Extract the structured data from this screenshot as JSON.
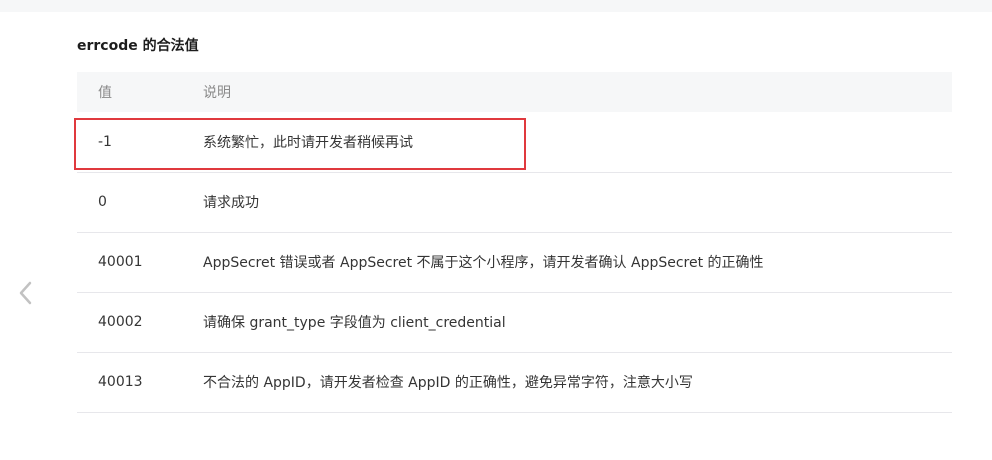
{
  "section": {
    "title": "errcode 的合法值"
  },
  "table": {
    "headers": {
      "value": "值",
      "description": "说明"
    },
    "rows": [
      {
        "value": "-1",
        "description": "系统繁忙，此时请开发者稍候再试"
      },
      {
        "value": "0",
        "description": "请求成功"
      },
      {
        "value": "40001",
        "description": "AppSecret 错误或者 AppSecret 不属于这个小程序，请开发者确认 AppSecret 的正确性"
      },
      {
        "value": "40002",
        "description": "请确保 grant_type 字段值为 client_credential"
      },
      {
        "value": "40013",
        "description": "不合法的 AppID，请开发者检查 AppID 的正确性，避免异常字符，注意大小写"
      }
    ]
  },
  "nav": {
    "back_icon": "chevron-left-icon"
  },
  "colors": {
    "highlight": "#e0393e",
    "header_bg": "#f6f7f8",
    "row_border": "#e7e7eb"
  }
}
